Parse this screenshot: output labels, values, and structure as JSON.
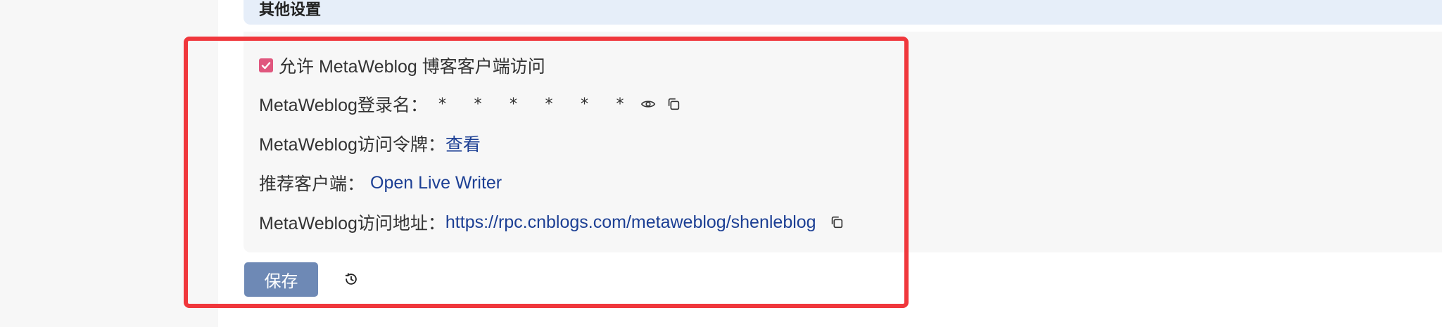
{
  "section_title": "其他设置",
  "allow_client": {
    "checked": true,
    "label": "允许 MetaWeblog 博客客户端访问"
  },
  "login_name": {
    "label": "MetaWeblog登录名：",
    "value": "* * * * * *",
    "icons": [
      "eye-icon",
      "copy-icon"
    ]
  },
  "access_token": {
    "label": "MetaWeblog访问令牌：",
    "link_text": "查看"
  },
  "recommended_client": {
    "label": "推荐客户端：",
    "link_text": "Open Live Writer"
  },
  "access_url": {
    "label": "MetaWeblog访问地址：",
    "url": "https://rpc.cnblogs.com/metaweblog/shenleblog",
    "icons": [
      "copy-icon"
    ]
  },
  "save_button": "保存",
  "history_icon": "history-icon",
  "colors": {
    "accent_checkbox": "#e0577e",
    "link": "#1c3f94",
    "save_button_bg": "#6e89b5",
    "highlight_frame": "#f0373c",
    "section_header_bg": "#e6eef9"
  }
}
